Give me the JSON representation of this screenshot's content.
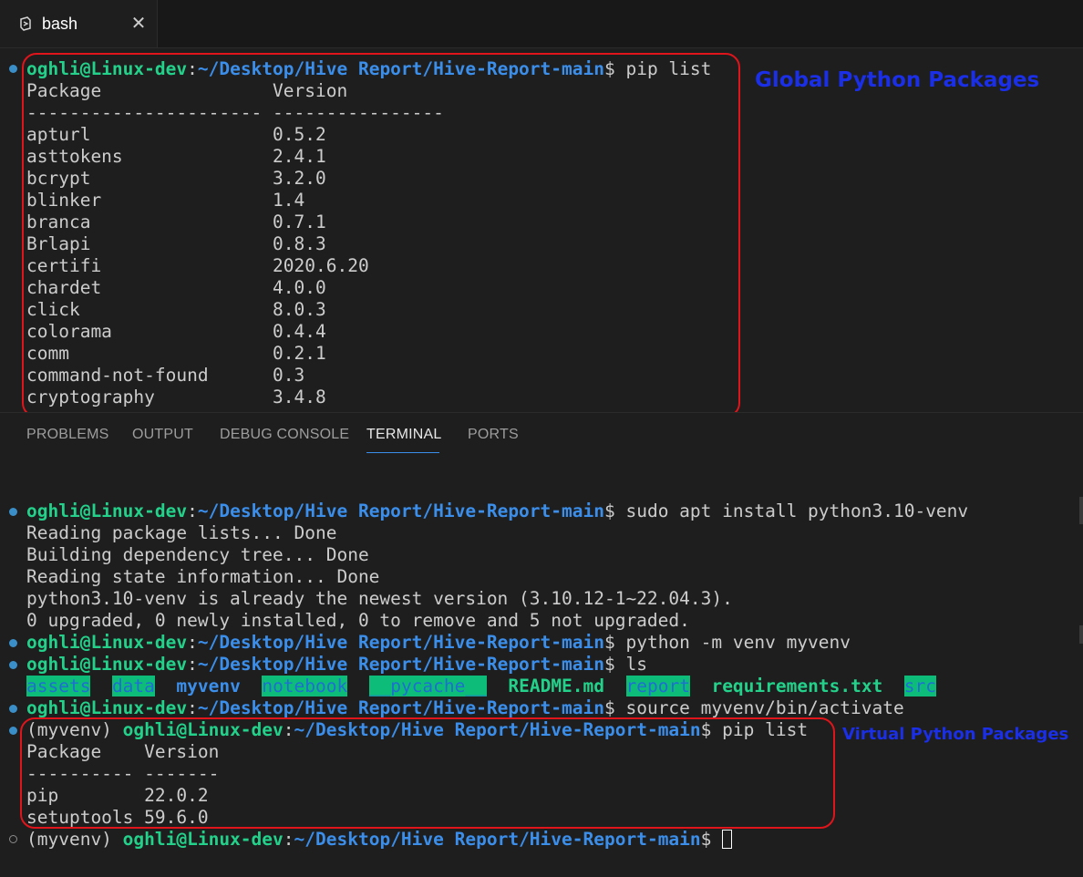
{
  "tab": {
    "label": "bash",
    "close": "✕"
  },
  "panel_tabs": [
    "PROBLEMS",
    "OUTPUT",
    "DEBUG CONSOLE",
    "TERMINAL",
    "PORTS"
  ],
  "prompt": {
    "user_host": "oghli@Linux-dev",
    "colon": ":",
    "path": "~/Desktop/Hive Report/Hive-Report-main",
    "dollar": "$",
    "venv": "(myvenv) "
  },
  "top": {
    "command": " pip list",
    "header": "Package                Version",
    "sep": "---------------------- ----------------",
    "packages": [
      [
        "apturl",
        "0.5.2"
      ],
      [
        "asttokens",
        "2.4.1"
      ],
      [
        "bcrypt",
        "3.2.0"
      ],
      [
        "blinker",
        "1.4"
      ],
      [
        "branca",
        "0.7.1"
      ],
      [
        "Brlapi",
        "0.8.3"
      ],
      [
        "certifi",
        "2020.6.20"
      ],
      [
        "chardet",
        "4.0.0"
      ],
      [
        "click",
        "8.0.3"
      ],
      [
        "colorama",
        "0.4.4"
      ],
      [
        "comm",
        "0.2.1"
      ],
      [
        "command-not-found",
        "0.3"
      ],
      [
        "cryptography",
        "3.4.8"
      ]
    ]
  },
  "bottom": {
    "cmd1": " sudo apt install python3.10-venv",
    "out1": [
      "Reading package lists... Done",
      "Building dependency tree... Done",
      "Reading state information... Done",
      "python3.10-venv is already the newest version (3.10.12-1~22.04.3).",
      "0 upgraded, 0 newly installed, 0 to remove and 5 not upgraded."
    ],
    "cmd2": " python -m venv myvenv",
    "cmd3": " ls",
    "ls": {
      "assets": "assets",
      "data": "data",
      "myvenv": "myvenv",
      "notebook": "notebook",
      "pycache": "__pycache__",
      "readme": "README.md",
      "report": "report",
      "requirements": "requirements.txt",
      "src": "src"
    },
    "cmd4": " source myvenv/bin/activate",
    "cmd5": " pip list",
    "venv_header": "Package    Version",
    "venv_sep": "---------- -------",
    "venv_packages": [
      [
        "pip",
        "22.0.2"
      ],
      [
        "setuptools",
        "59.6.0"
      ]
    ]
  },
  "annotations": {
    "global": "Global Python Packages",
    "virtual": "Virtual Python Packages",
    "box_color": "#e0141b",
    "label_color": "#1a2fe6"
  }
}
